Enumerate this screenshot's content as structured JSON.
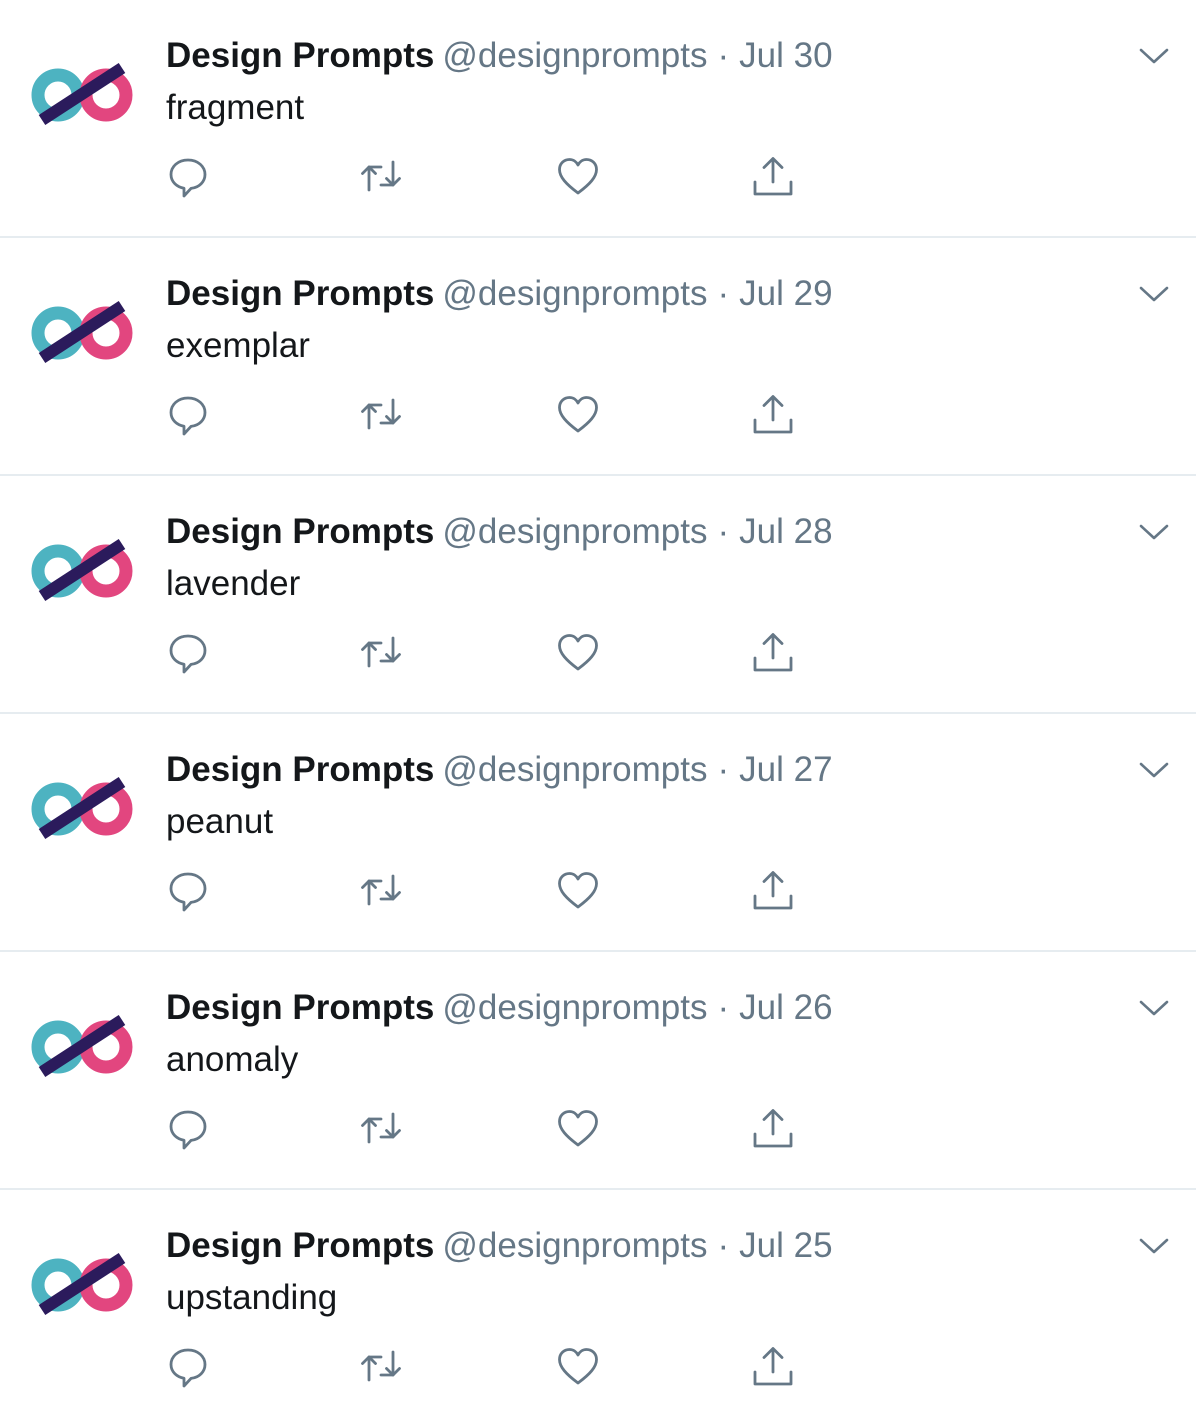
{
  "tweets": [
    {
      "name": "Design Prompts",
      "handle": "@designprompts",
      "separator": "·",
      "date": "Jul 30",
      "text": "fragment"
    },
    {
      "name": "Design Prompts",
      "handle": "@designprompts",
      "separator": "·",
      "date": "Jul 29",
      "text": "exemplar"
    },
    {
      "name": "Design Prompts",
      "handle": "@designprompts",
      "separator": "·",
      "date": "Jul 28",
      "text": "lavender"
    },
    {
      "name": "Design Prompts",
      "handle": "@designprompts",
      "separator": "·",
      "date": "Jul 27",
      "text": "peanut"
    },
    {
      "name": "Design Prompts",
      "handle": "@designprompts",
      "separator": "·",
      "date": "Jul 26",
      "text": "anomaly"
    },
    {
      "name": "Design Prompts",
      "handle": "@designprompts",
      "separator": "·",
      "date": "Jul 25",
      "text": "upstanding"
    }
  ],
  "icons": {
    "avatar": "infinity-logo-icon",
    "caret": "chevron-down-icon",
    "reply": "reply-icon",
    "retweet": "retweet-icon",
    "like": "heart-icon",
    "share": "share-icon"
  },
  "colors": {
    "text_primary": "#14171a",
    "text_secondary": "#657786",
    "divider": "#e6ecf0",
    "logo_teal": "#4db3c1",
    "logo_pink": "#e2467f",
    "logo_navy": "#2b1b5c"
  }
}
